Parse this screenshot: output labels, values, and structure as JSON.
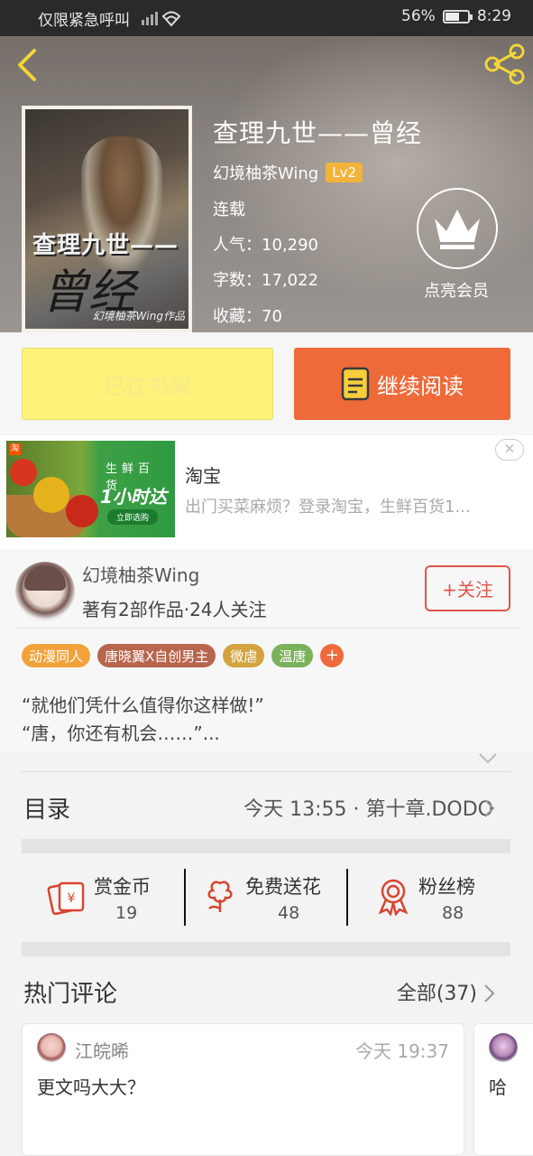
{
  "status_bar": {
    "carrier": "仅限紧急呼叫",
    "battery": "56%",
    "time": "8:29"
  },
  "book": {
    "title": "查理九世——曾经",
    "author": "幻境柚茶Wing",
    "level": "Lv2",
    "status": "连载",
    "popularity": "人气：10,290",
    "word_count": "字数：17,022",
    "favorites": "收藏：70",
    "vip_label": "点亮会员",
    "cover_title_1": "查理九世——",
    "cover_title_2": "曾经",
    "cover_author": "幻境柚茶Wing作品"
  },
  "actions": {
    "shelf": "已在书架",
    "read": "继续阅读"
  },
  "ad": {
    "title": "淘宝",
    "description": "出门买菜麻烦？登录淘宝，生鲜百货1...",
    "banner_tag": "生鲜百货",
    "banner_big": "1小时达",
    "banner_button": "立即选购",
    "close": "✕"
  },
  "author_card": {
    "name": "幻境柚茶Wing",
    "stats": "著有2部作品·24人关注",
    "follow": "+关注",
    "tags": [
      {
        "label": "动漫同人",
        "color": "#f2a23a"
      },
      {
        "label": "唐晓翼X自创男主",
        "color": "#b8654d"
      },
      {
        "label": "微虐",
        "color": "#d4a33e"
      },
      {
        "label": "温唐",
        "color": "#7bb15a"
      }
    ],
    "tag_plus": "+",
    "description_line1": "“就他们凭什么值得你这样做!”",
    "description_line2": "“唐，你还有机会……”..."
  },
  "catalog": {
    "label": "目录",
    "latest": "今天 13:55 · 第十章.DODO"
  },
  "stats": [
    {
      "label": "赏金币",
      "value": "19",
      "icon": "coin-envelope-icon"
    },
    {
      "label": "免费送花",
      "value": "48",
      "icon": "flower-icon"
    },
    {
      "label": "粉丝榜",
      "value": "88",
      "icon": "medal-icon"
    }
  ],
  "comments": {
    "label": "热门评论",
    "all": "全部(37)",
    "items": [
      {
        "user": "江皖晞",
        "time": "今天 19:37",
        "text": "更文吗大大？"
      },
      {
        "text": "哈"
      }
    ]
  },
  "colors": {
    "accent": "#ee6a39",
    "shelf": "#fdf27a",
    "level_badge": "#f2b33b",
    "follow": "#e0564a"
  }
}
